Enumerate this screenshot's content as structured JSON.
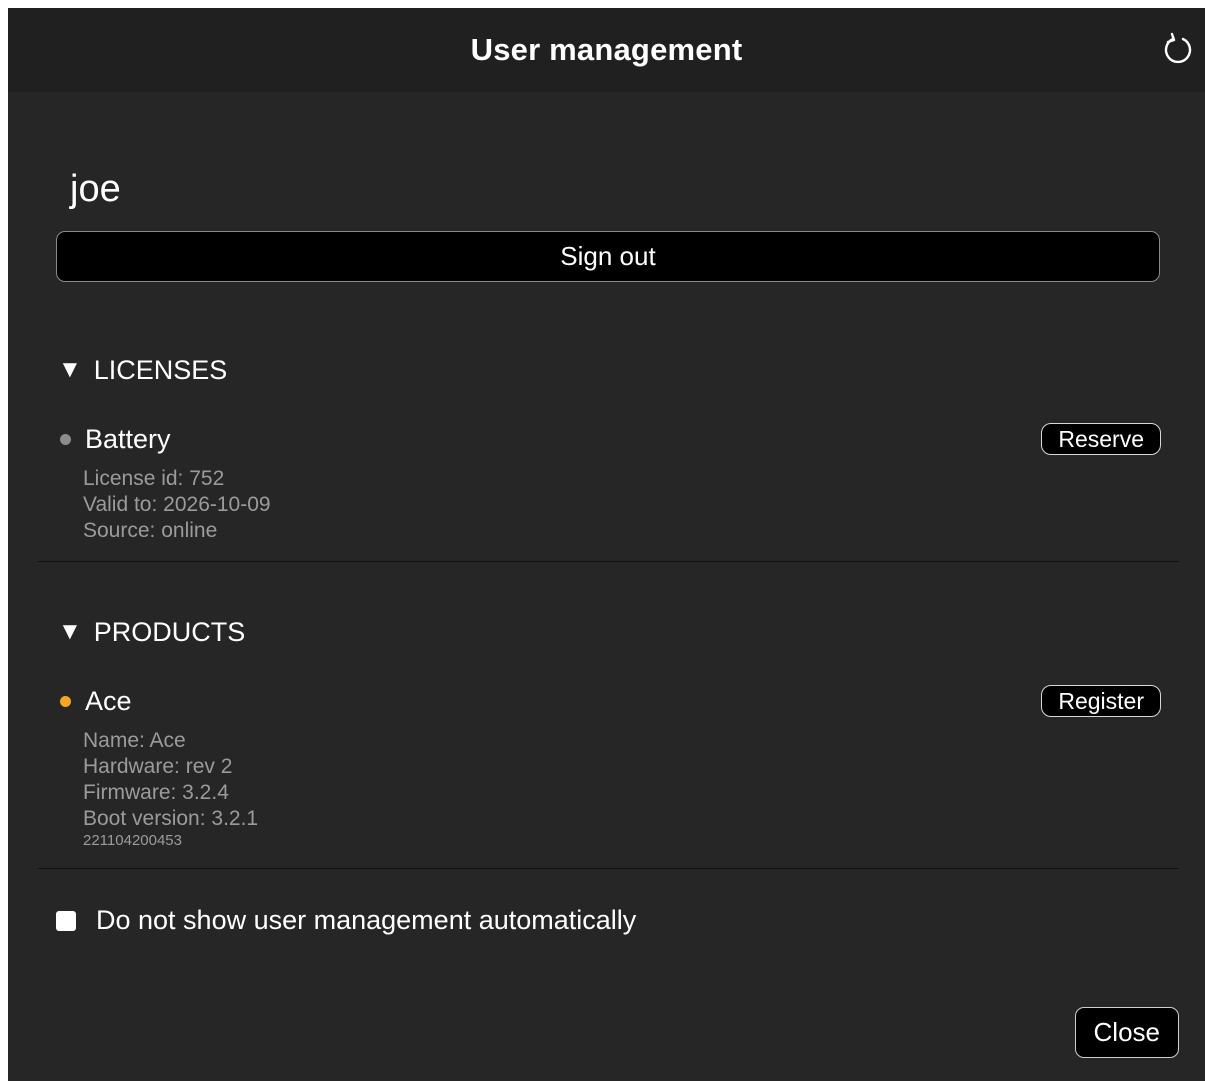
{
  "window": {
    "title": "User management",
    "refresh_icon": "refresh-icon"
  },
  "user": {
    "name": "joe",
    "sign_out_label": "Sign out"
  },
  "licenses": {
    "header": "LICENSES",
    "toggle_icon": "triangle-down-icon",
    "items": [
      {
        "name": "Battery",
        "status_color": "#8c8c8c",
        "details": [
          "License id: 752",
          "Valid to: 2026-10-09",
          "Source: online"
        ],
        "action_label": "Reserve"
      }
    ]
  },
  "products": {
    "header": "PRODUCTS",
    "toggle_icon": "triangle-down-icon",
    "items": [
      {
        "name": "Ace",
        "status_color": "#f5a623",
        "details": [
          "Name: Ace",
          "Hardware: rev 2",
          "Firmware: 3.2.4",
          "Boot version: 3.2.1"
        ],
        "build": "221104200453",
        "action_label": "Register"
      }
    ]
  },
  "options": {
    "auto_show_label": "Do not show user management automatically",
    "auto_show_checked": false
  },
  "footer": {
    "close_label": "Close"
  }
}
